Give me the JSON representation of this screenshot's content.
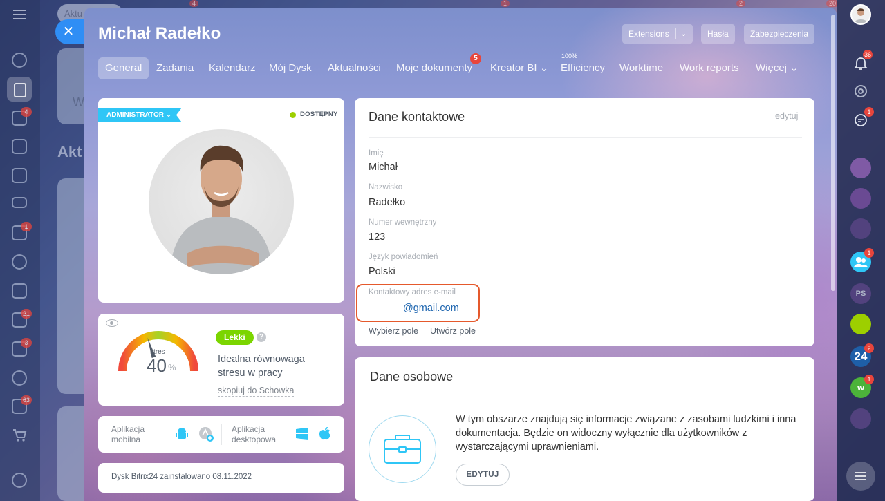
{
  "background": {
    "tab_pill": "Aktu",
    "text_fragment": "Akt",
    "card_fragment": "W"
  },
  "left_sidebar": {
    "badges": [
      "4",
      "1",
      "21",
      "3",
      "63"
    ],
    "top_badges": [
      "4",
      "1",
      "2",
      "20"
    ]
  },
  "modal": {
    "title": "Michał Radełko",
    "header_buttons": {
      "extensions": "Extensions",
      "hasla": "Hasła",
      "zabezpieczenia": "Zabezpieczenia"
    },
    "tabs": [
      {
        "label": "General"
      },
      {
        "label": "Zadania"
      },
      {
        "label": "Kalendarz"
      },
      {
        "label": "Mój Dysk"
      },
      {
        "label": "Aktualności"
      },
      {
        "label": "Moje dokumenty",
        "badge": "5"
      },
      {
        "label": "Kreator BI ⌄"
      },
      {
        "label": "Efficiency",
        "sup": "100%"
      },
      {
        "label": "Worktime"
      },
      {
        "label": "Work reports"
      },
      {
        "label": "Więcej ⌄"
      }
    ]
  },
  "profile": {
    "role": "ADMINISTRATOR ⌄",
    "status": "DOSTĘPNY"
  },
  "stress": {
    "label": "stres",
    "value": "40",
    "unit": "%",
    "level": 0.4,
    "badge": "Lekki",
    "help": "?",
    "description": "Idealna równowaga stresu w pracy",
    "copy_link": "skopiuj do Schowka"
  },
  "apps": {
    "mobile": "Aplikacja mobilna",
    "desktop": "Aplikacja desktopowa"
  },
  "dysk": {
    "text": "Dysk Bitrix24 zainstalowano 08.11.2022"
  },
  "contact": {
    "title": "Dane kontaktowe",
    "edit": "edytuj",
    "fields": [
      {
        "label": "Imię",
        "value": "Michał"
      },
      {
        "label": "Nazwisko",
        "value": "Radełko"
      },
      {
        "label": "Numer wewnętrzny",
        "value": "123"
      },
      {
        "label": "Język powiadomień",
        "value": "Polski"
      }
    ],
    "email_label": "Kontaktowy adres e-mail",
    "email_value": "@gmail.com",
    "choose_field": "Wybierz pole",
    "create_field": "Utwórz pole"
  },
  "personal": {
    "title": "Dane osobowe",
    "description": "W tym obszarze znajdują się informacje związane z zasobami ludzkimi i inna dokumentacja. Będzie on widoczny wyłącznie dla użytkowników z wystarczającymi uprawnieniami.",
    "button": "EDYTUJ"
  },
  "right_sidebar": {
    "notifications_badge": "36",
    "chat_badge": "1",
    "group_badge": "1",
    "ps_label": "PS",
    "b24_label": "24",
    "b24_badge": "2",
    "w_label": "w",
    "w_badge": "1"
  },
  "colors": {
    "accent_blue": "#2f8ef5",
    "admin_ribbon": "#2fc6f6",
    "status_green": "#9dcf00",
    "lekki_green": "#7bd500",
    "highlight_orange": "#e5592c",
    "badge_red": "#e8453c"
  }
}
